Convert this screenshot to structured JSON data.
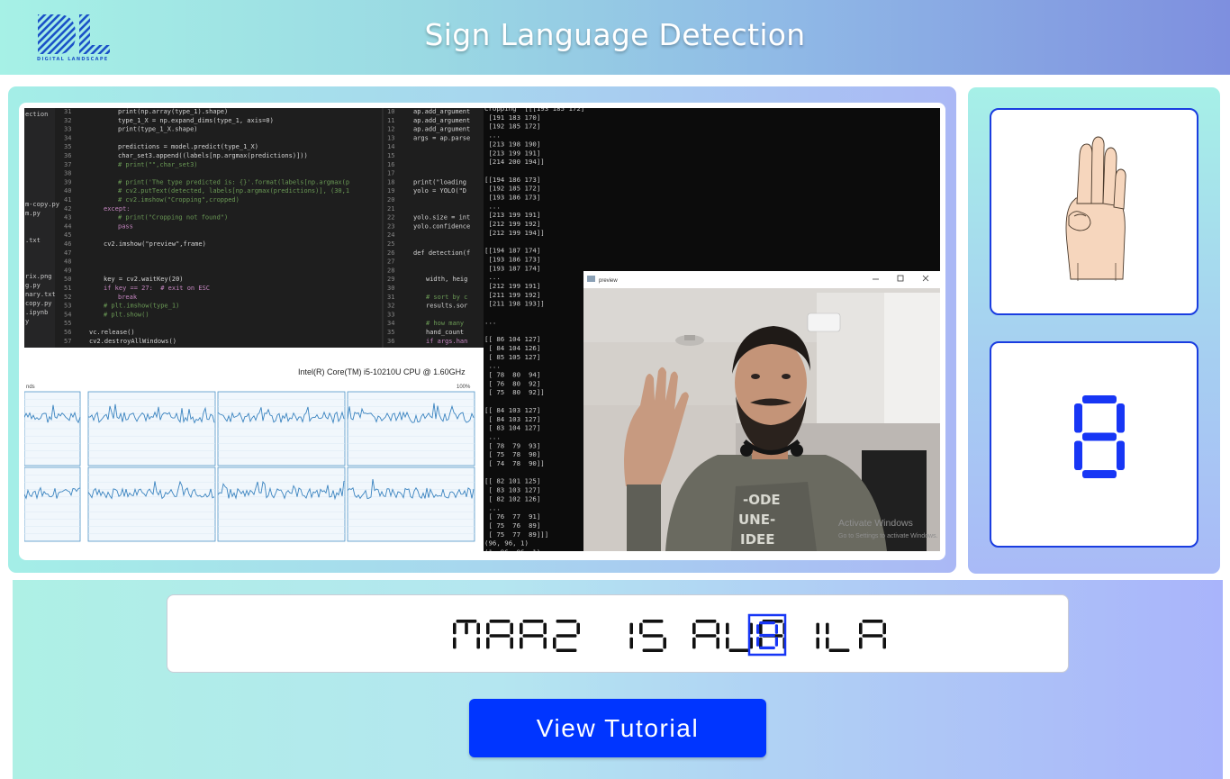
{
  "header": {
    "title": "Sign Language Detection",
    "logo_caption": "DIGITAL LANDSCAPE"
  },
  "video_feed": {
    "cpu_label": "Intel(R) Core(TM) i5-10210U CPU @ 1.60GHz",
    "cpu_left_label": "nds",
    "cpu_percent": "100%",
    "preview_window_title": "preview",
    "watermark_line1": "Activate Windows",
    "watermark_line2": "Go to Settings to activate Windows.",
    "file_list": [
      "ection",
      "",
      "",
      "",
      "",
      "",
      "",
      "",
      "",
      "",
      "m-copy.py",
      "m.py",
      "",
      "",
      ".txt",
      "",
      "",
      "",
      "rix.png",
      "g.py",
      "nary.txt",
      "copy.py",
      ".ipynb",
      "y"
    ],
    "code_lines": [
      {
        "n": "31",
        "t": "print(np.array(type_1).shape)"
      },
      {
        "n": "32",
        "t": "type_1_X = np.expand_dims(type_1, axis=0)"
      },
      {
        "n": "33",
        "t": "print(type_1_X.shape)"
      },
      {
        "n": "34",
        "t": ""
      },
      {
        "n": "35",
        "t": "predictions = model.predict(type_1_X)"
      },
      {
        "n": "36",
        "t": "char_set3.append((labels[np.argmax(predictions)]))"
      },
      {
        "n": "37",
        "t": "# print(\"\",char_set3)"
      },
      {
        "n": "38",
        "t": ""
      },
      {
        "n": "39",
        "t": "# print('The type predicted is: {}'.format(labels[np.argmax(p"
      },
      {
        "n": "40",
        "t": "# cv2.putText(detected, labels[np.argmax(predictions)], (30,1"
      },
      {
        "n": "41",
        "t": "# cv2.imshow(\"Cropping\",cropped)"
      },
      {
        "n": "42",
        "t": "except:"
      },
      {
        "n": "43",
        "t": "# print(\"Cropping not found\")"
      },
      {
        "n": "44",
        "t": "pass"
      },
      {
        "n": "45",
        "t": ""
      },
      {
        "n": "46",
        "t": "cv2.imshow(\"preview\",frame)"
      },
      {
        "n": "47",
        "t": ""
      },
      {
        "n": "48",
        "t": ""
      },
      {
        "n": "49",
        "t": ""
      },
      {
        "n": "50",
        "t": "key = cv2.waitKey(20)"
      },
      {
        "n": "51",
        "t": "if key == 27:  # exit on ESC"
      },
      {
        "n": "52",
        "t": "break"
      },
      {
        "n": "53",
        "t": "# plt.imshow(type_1)"
      },
      {
        "n": "54",
        "t": "# plt.show()"
      },
      {
        "n": "55",
        "t": ""
      },
      {
        "n": "56",
        "t": "vc.release()"
      },
      {
        "n": "57",
        "t": "cv2.destroyAllWindows()"
      }
    ],
    "code2_lines": [
      {
        "n": "10",
        "t": "ap.add_argument"
      },
      {
        "n": "11",
        "t": "ap.add_argument"
      },
      {
        "n": "12",
        "t": "ap.add_argument"
      },
      {
        "n": "13",
        "t": "args = ap.parse"
      },
      {
        "n": "14",
        "t": ""
      },
      {
        "n": "15",
        "t": ""
      },
      {
        "n": "16",
        "t": ""
      },
      {
        "n": "17",
        "t": ""
      },
      {
        "n": "18",
        "t": "print(\"loading"
      },
      {
        "n": "19",
        "t": "yolo = YOLO(\"D"
      },
      {
        "n": "20",
        "t": ""
      },
      {
        "n": "21",
        "t": ""
      },
      {
        "n": "22",
        "t": "yolo.size = int"
      },
      {
        "n": "23",
        "t": "yolo.confidence"
      },
      {
        "n": "24",
        "t": ""
      },
      {
        "n": "25",
        "t": ""
      },
      {
        "n": "26",
        "t": "def detection(f"
      },
      {
        "n": "27",
        "t": ""
      },
      {
        "n": "28",
        "t": ""
      },
      {
        "n": "29",
        "t": "width, heig"
      },
      {
        "n": "30",
        "t": ""
      },
      {
        "n": "31",
        "t": "# sort by c"
      },
      {
        "n": "32",
        "t": "results.sor"
      },
      {
        "n": "33",
        "t": ""
      },
      {
        "n": "34",
        "t": "# how many"
      },
      {
        "n": "35",
        "t": "hand_count"
      },
      {
        "n": "36",
        "t": "if args.han"
      }
    ],
    "console_lines": [
      "Cropping  [[[193 185 172]",
      " [191 183 170]",
      " [192 185 172]",
      " ...",
      " [213 198 190]",
      " [213 199 191]",
      " [214 200 194]]",
      "",
      "[[194 186 173]",
      " [192 185 172]",
      " [193 186 173]",
      " ...",
      " [213 199 191]",
      " [212 199 192]",
      " [212 199 194]]",
      "",
      "[[194 187 174]",
      " [193 186 173]",
      " [193 187 174]",
      " ...",
      " [212 199 191]",
      " [211 199 192]",
      " [211 198 193]]",
      "",
      "...",
      "",
      "[[ 86 104 127]",
      " [ 84 104 126]",
      " [ 85 105 127]",
      " ...",
      " [ 78  80  94]",
      " [ 76  80  92]",
      " [ 75  80  92]]",
      "",
      "[[ 84 103 127]",
      " [ 84 103 127]",
      " [ 83 104 127]",
      " ...",
      " [ 78  79  93]",
      " [ 75  78  90]",
      " [ 74  78  90]]",
      "",
      "[[ 82 101 125]",
      " [ 83 103 127]",
      " [ 82 102 126]",
      " ...",
      " [ 76  77  91]",
      " [ 75  76  89]",
      " [ 75  77  89]]]",
      "(96, 96, 1)",
      "(1, 96, 96, 1)"
    ]
  },
  "prediction": {
    "hand_sign_icon": "raised-hand-sign-b-icon",
    "letter": "B",
    "letter_color": "#1736f5"
  },
  "sentence": {
    "prefix": "MAAZ IS AVAILA",
    "current_letter": "B",
    "text_color": "#111111",
    "accent_color": "#1736f5"
  },
  "actions": {
    "tutorial_label": "View Tutorial"
  },
  "colors": {
    "button": "#0035ff",
    "card_border": "#1a3de0"
  }
}
